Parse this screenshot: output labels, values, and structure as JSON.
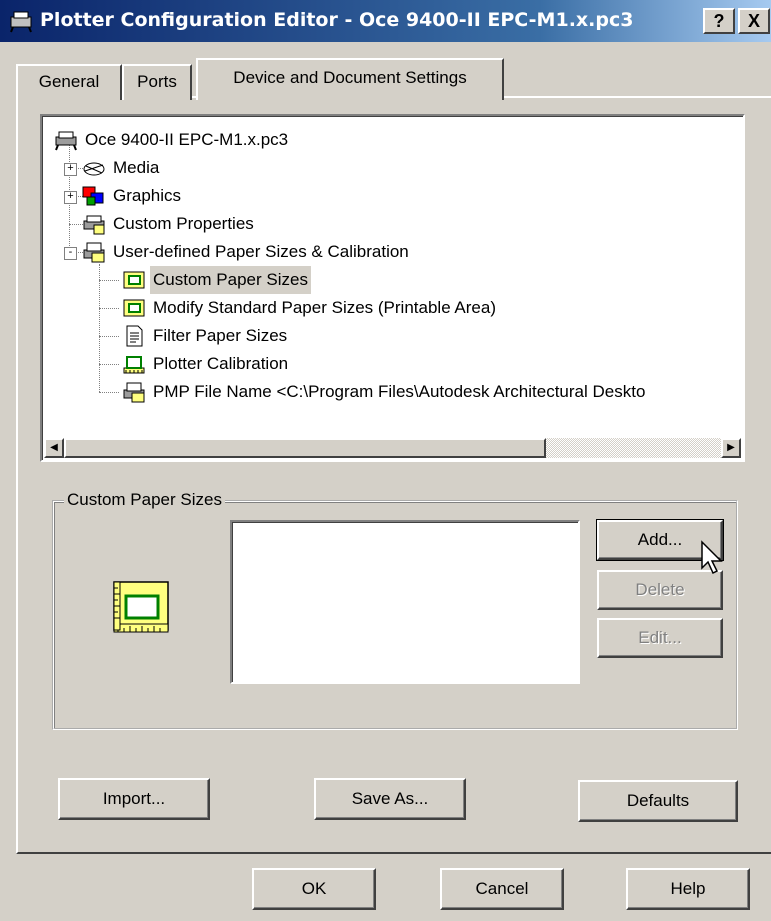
{
  "window": {
    "title": "Plotter Configuration Editor - Oce 9400-II EPC-M1.x.pc3",
    "help_label": "?",
    "close_label": "X"
  },
  "tabs": [
    {
      "label": "General",
      "active": false
    },
    {
      "label": "Ports",
      "active": false
    },
    {
      "label": "Device and Document Settings",
      "active": true
    }
  ],
  "tree": {
    "root": "Oce 9400-II EPC-M1.x.pc3",
    "items": [
      {
        "label": "Media",
        "expander": "+"
      },
      {
        "label": "Graphics",
        "expander": "+"
      },
      {
        "label": "Custom Properties"
      },
      {
        "label": "User-defined Paper Sizes & Calibration",
        "expander": "-"
      },
      {
        "label": "Custom Paper Sizes",
        "selected": true
      },
      {
        "label": "Modify Standard Paper Sizes (Printable Area)"
      },
      {
        "label": "Filter Paper Sizes"
      },
      {
        "label": "Plotter Calibration"
      },
      {
        "label": "PMP File Name <C:\\Program Files\\Autodesk Architectural Deskto"
      }
    ]
  },
  "scrollbar": {
    "left_arrow": "◀",
    "right_arrow": "▶"
  },
  "group": {
    "legend": "Custom Paper Sizes",
    "buttons": {
      "add": "Add...",
      "delete": "Delete",
      "edit": "Edit..."
    }
  },
  "panel_buttons": {
    "import": "Import...",
    "save_as": "Save As...",
    "defaults": "Defaults"
  },
  "dialog_buttons": {
    "ok": "OK",
    "cancel": "Cancel",
    "help": "Help"
  },
  "icons": {
    "title": "plotter-icon",
    "paper": "custom-paper-size-icon",
    "cursor": "mouse-pointer-icon"
  }
}
